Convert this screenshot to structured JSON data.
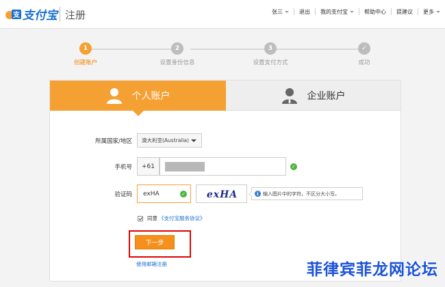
{
  "header": {
    "logo_text": "支付宝",
    "subtitle": "注册",
    "nav": [
      {
        "label": "张三",
        "dropdown": true
      },
      {
        "label": "退出",
        "dropdown": false
      },
      {
        "label": "我的支付宝",
        "dropdown": true
      },
      {
        "label": "帮助中心",
        "dropdown": false
      },
      {
        "label": "提建议",
        "dropdown": false
      },
      {
        "label": "更多",
        "dropdown": true
      }
    ]
  },
  "steps": [
    {
      "number": "1",
      "label": "创建账户",
      "state": "active"
    },
    {
      "number": "2",
      "label": "设置身份信息",
      "state": "pending"
    },
    {
      "number": "3",
      "label": "设置支付方式",
      "state": "pending"
    },
    {
      "number": "✓",
      "label": "成功",
      "state": "pending"
    }
  ],
  "tabs": {
    "personal": "个人账户",
    "company": "企业账户"
  },
  "form": {
    "country_label": "所属国家/地区",
    "country_value": "澳大利亚(Australia)",
    "phone_label": "手机号",
    "phone_prefix": "+61",
    "code_label": "验证码",
    "code_value": "exHA",
    "captcha_text": "exHA",
    "captcha_tip": "输入图片中的字符，不区分大小写。",
    "agree_label": "同意",
    "agree_link": "《支付宝服务协议》",
    "next_button": "下一步",
    "email_link": "使用邮箱注册"
  },
  "watermark": "菲律宾菲龙网论坛",
  "colors": {
    "accent_orange": "#f5a033",
    "brand_blue": "#1a6fd1",
    "success_green": "#4cb43c",
    "highlight_red": "#e00000"
  }
}
